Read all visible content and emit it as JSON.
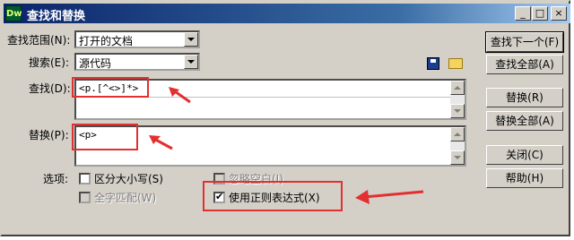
{
  "window": {
    "icon_text": "Dw",
    "title": "查找和替换",
    "min_symbol": "_",
    "max_symbol": "□",
    "close_symbol": "×"
  },
  "form": {
    "scope_label": "查找范围(N):",
    "scope_value": "打开的文档",
    "search_label": "搜索(E):",
    "search_value": "源代码",
    "find_label": "查找(D):",
    "find_value": "<p.[^<>]*>",
    "replace_label": "替换(P):",
    "replace_value": "<p>",
    "options_label": "选项:",
    "options": {
      "match_case": "区分大小写(S)",
      "ignore_whitespace": "忽略空白(I)",
      "whole_word": "全字匹配(W)",
      "use_regex": "使用正则表达式(X)"
    }
  },
  "buttons": {
    "find_next": "查找下一个(F)",
    "find_all": "查找全部(A)",
    "replace": "替换(R)",
    "replace_all": "替换全部(A)",
    "close": "关闭(C)",
    "help": "帮助(H)"
  },
  "state": {
    "match_case_checked": false,
    "ignore_whitespace_checked": false,
    "whole_word_checked": false,
    "use_regex_checked": true
  },
  "colors": {
    "annotation_red": "#e23030",
    "titlebar_start": "#0a246a",
    "dialog_bg": "#d4d0c8"
  },
  "icons": [
    "save-disk-icon",
    "open-folder-icon"
  ]
}
